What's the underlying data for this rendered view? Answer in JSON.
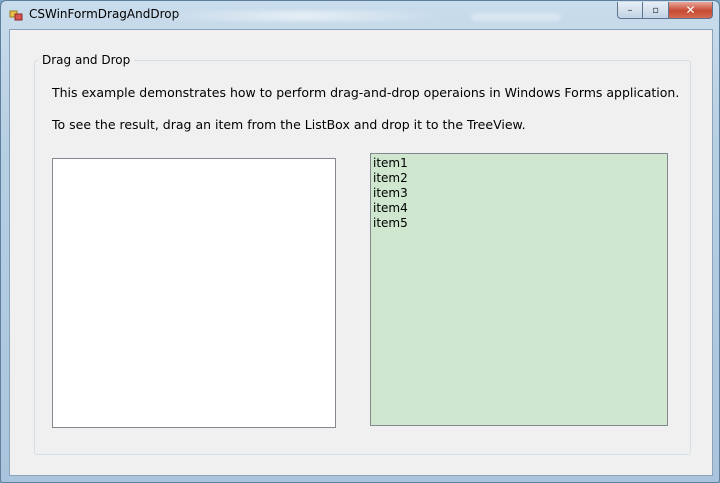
{
  "window": {
    "title": "CSWinFormDragAndDrop",
    "minimize_glyph": "–",
    "maximize_glyph": "▫",
    "close_glyph": "✕"
  },
  "group": {
    "legend": "Drag and Drop",
    "description_line1": "This example demonstrates how to perform drag-and-drop operaions in Windows Forms application.",
    "description_line2": "To see the result, drag an item from the ListBox and drop it to the TreeView."
  },
  "listbox": {
    "items": []
  },
  "treeview": {
    "items": [
      "item1",
      "item2",
      "item3",
      "item4",
      "item5"
    ]
  }
}
